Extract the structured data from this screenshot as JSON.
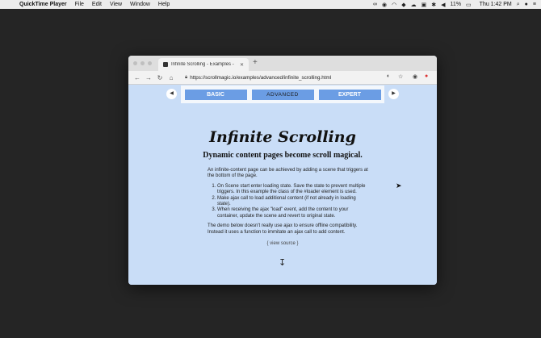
{
  "menubar": {
    "app_name": "QuickTime Player",
    "items": [
      "File",
      "Edit",
      "View",
      "Window",
      "Help"
    ],
    "battery": "11%",
    "clock": "Thu 1:42 PM"
  },
  "browser": {
    "tab_title": "Infinite Scrolling - Examples - ",
    "url": "https://scrollmagic.io/examples/advanced/infinite_scrolling.html"
  },
  "page": {
    "nav_tabs": [
      "BASIC",
      "ADVANCED",
      "EXPERT"
    ],
    "title": "Infinite Scrolling",
    "subtitle": "Dynamic content pages become scroll magical.",
    "intro": "An infinite-content page can be achieved by adding a scene that triggers at the bottom of the page.",
    "steps": [
      "On Scene start enter loading state. Save the state to prevent multiple triggers. In this example the class of the #loader element is used.",
      "Make ajax call to load additional content (if not already in loading state).",
      "When receiving the ajax \"load\" event, add the content to your container, update the scene and revert to original state."
    ],
    "note": "The demo below doesn't really use ajax to ensure offline compatibility. Instead it uses a function to immitate an ajax call to add content.",
    "view_source": "{ view source }"
  }
}
